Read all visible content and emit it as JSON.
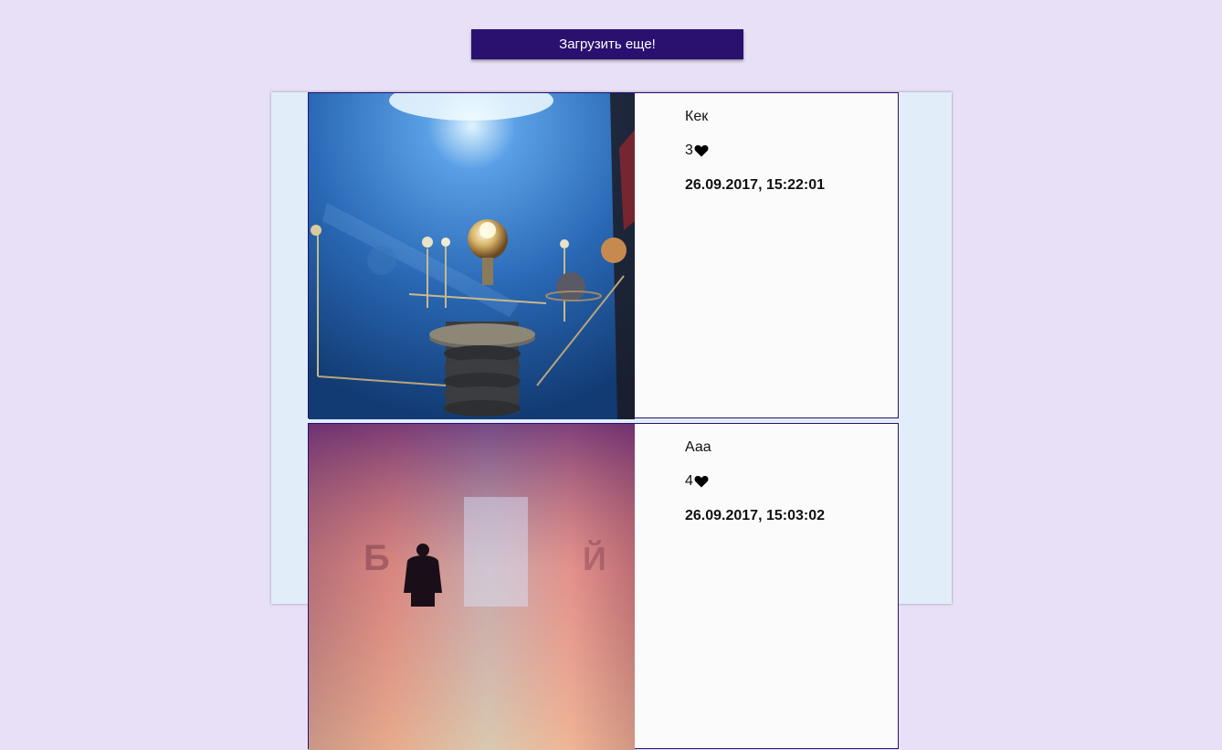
{
  "toolbar": {
    "load_more_label": "Загрузить еще!"
  },
  "posts": [
    {
      "caption": "Кек",
      "likes": "3",
      "date": "26.09.2017, 15:22:01",
      "image_icon": "orrery-photo"
    },
    {
      "caption": "Ааа",
      "likes": "4",
      "date": "26.09.2017, 15:03:02",
      "image_icon": "planetarium-silhouette-photo"
    }
  ],
  "colors": {
    "page_background": "#e8e0f6",
    "feed_background": "#e1eefa",
    "button_background": "#2a1170",
    "card_border": "#2a1170",
    "card_background": "#fbfbfc"
  }
}
